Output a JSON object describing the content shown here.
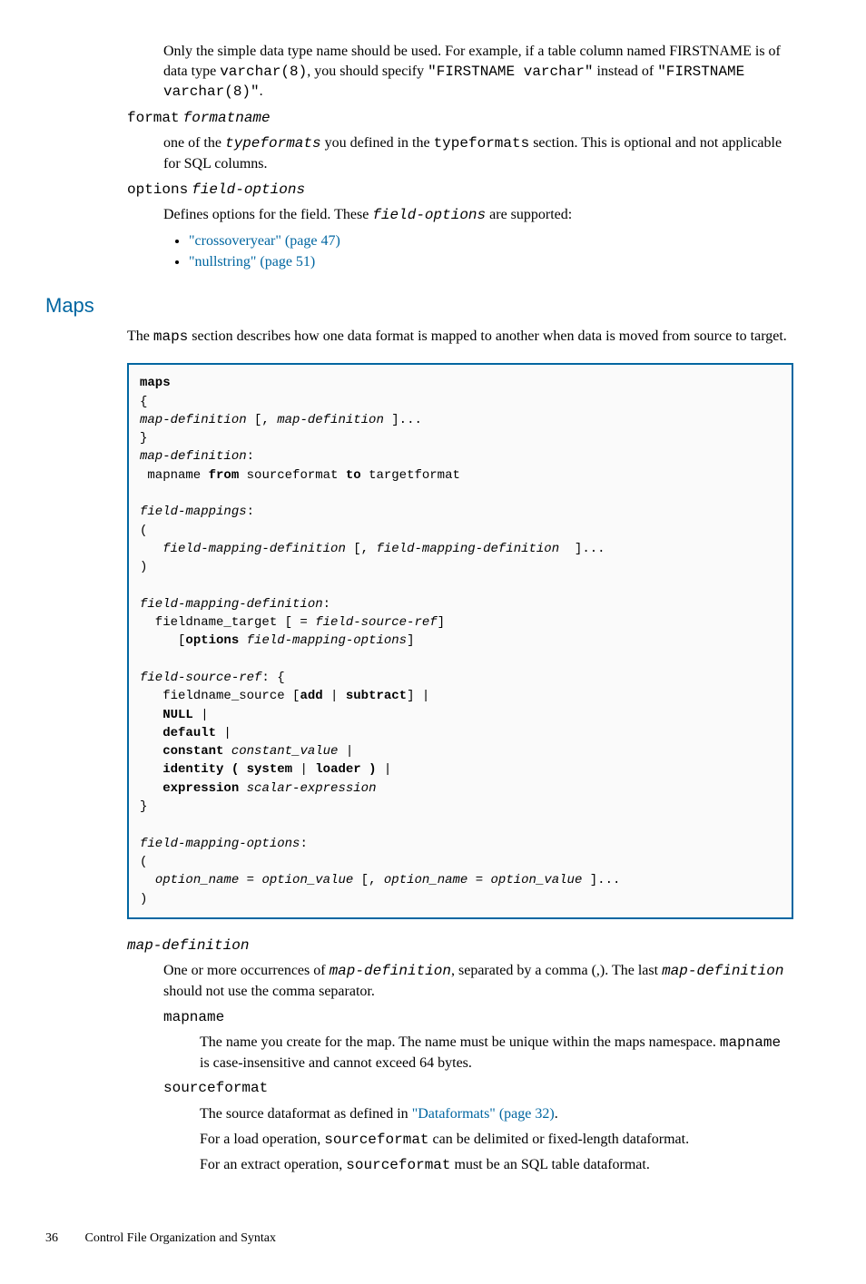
{
  "top": {
    "para1_pre": "Only the simple data type name should be used. For example, if a table column named FIRSTNAME is of data type ",
    "para1_code1": "varchar(8)",
    "para1_mid": ", you should specify ",
    "para1_code2": "\"FIRSTNAME varchar\"",
    "para1_mid2": " instead of ",
    "para1_code3": "\"FIRSTNAME varchar(8)\"",
    "para1_end": "."
  },
  "format_dt_kw": "format",
  "format_dt_arg": "formatname",
  "format_dd_pre": "one of the ",
  "format_dd_code1": "typeformats",
  "format_dd_mid": " you defined in the ",
  "format_dd_code2": "typeformats",
  "format_dd_end": " section. This is optional and not applicable for SQL columns.",
  "options_dt_kw": "options",
  "options_dt_arg": "field-options",
  "options_dd_pre": "Defines options for the field. These ",
  "options_dd_code": "field-options",
  "options_dd_end": " are supported:",
  "options_li1": "\"crossoveryear\" (page 47)",
  "options_li2": "\"nullstring\" (page 51)",
  "maps_heading": "Maps",
  "maps_intro_pre": "The ",
  "maps_intro_code": "maps",
  "maps_intro_end": " section describes how one data format is mapped to another when data is moved from source to target.",
  "syntax": {
    "l1": "maps",
    "l2": "{",
    "l3a": "map-definition",
    "l3b": " [, ",
    "l3c": "map-definition",
    "l3d": " ]...",
    "l4": "}",
    "l5a": "map-definition",
    "l5b": ":",
    "l6a": " mapname ",
    "l6b": "from",
    "l6c": " sourceformat ",
    "l6d": "to",
    "l6e": " targetformat",
    "l8a": "field-mappings",
    "l8b": ":",
    "l9": "(",
    "l10a": "   ",
    "l10b": "field-mapping-definition",
    "l10c": " [, ",
    "l10d": "field-mapping-definition",
    "l10e": "  ]...",
    "l11": ")",
    "l13a": "field-mapping-definition",
    "l13b": ":",
    "l14a": "  fieldname_target [ = ",
    "l14b": "field-source-ref",
    "l14c": "]",
    "l15a": "     [",
    "l15b": "options",
    "l15c": " ",
    "l15d": "field-mapping-options",
    "l15e": "]",
    "l17a": "field-source-ref",
    "l17b": ": {",
    "l18a": "   fieldname_source [",
    "l18b": "add",
    "l18c": " | ",
    "l18d": "subtract",
    "l18e": "] |",
    "l19a": "   ",
    "l19b": "NULL",
    "l19c": " |",
    "l20a": "   ",
    "l20b": "default",
    "l20c": " |",
    "l21a": "   ",
    "l21b": "constant",
    "l21c": " ",
    "l21d": "constant_value",
    "l21e": " |",
    "l22a": "   ",
    "l22b": "identity ( system",
    "l22c": " | ",
    "l22d": "loader )",
    "l22e": " |",
    "l23a": "   ",
    "l23b": "expression",
    "l23c": " ",
    "l23d": "scalar-expression",
    "l24": "}",
    "l26a": "field-mapping-options",
    "l26b": ":",
    "l27": "(",
    "l28a": "  ",
    "l28b": "option_name",
    "l28c": " = ",
    "l28d": "option_value",
    "l28e": " [, ",
    "l28f": "option_name",
    "l28g": " = ",
    "l28h": "option_value",
    "l28i": " ]...",
    "l29": ")"
  },
  "mapdef_dt": "map-definition",
  "mapdef_dd_pre": "One or more occurrences of ",
  "mapdef_dd_code1": "map-definition",
  "mapdef_dd_mid": ", separated by a comma (,). The last ",
  "mapdef_dd_code2": "map-definition",
  "mapdef_dd_end": " should not use the comma separator.",
  "mapname_dt": "mapname",
  "mapname_dd_pre": "The name you create for the map. The name must be unique within the maps namespace. ",
  "mapname_dd_code": "mapname",
  "mapname_dd_end": " is case-insensitive and cannot exceed 64 bytes.",
  "srcfmt_dt": "sourceformat",
  "srcfmt_p1_pre": "The source dataformat as defined in ",
  "srcfmt_p1_link": "\"Dataformats\" (page 32)",
  "srcfmt_p1_end": ".",
  "srcfmt_p2_pre": "For a load operation, ",
  "srcfmt_p2_code": "sourceformat",
  "srcfmt_p2_end": " can be delimited or fixed-length dataformat.",
  "srcfmt_p3_pre": "For an extract operation, ",
  "srcfmt_p3_code": "sourceformat",
  "srcfmt_p3_end": " must be an SQL table dataformat.",
  "footer_page": "36",
  "footer_text": "Control File Organization and Syntax"
}
